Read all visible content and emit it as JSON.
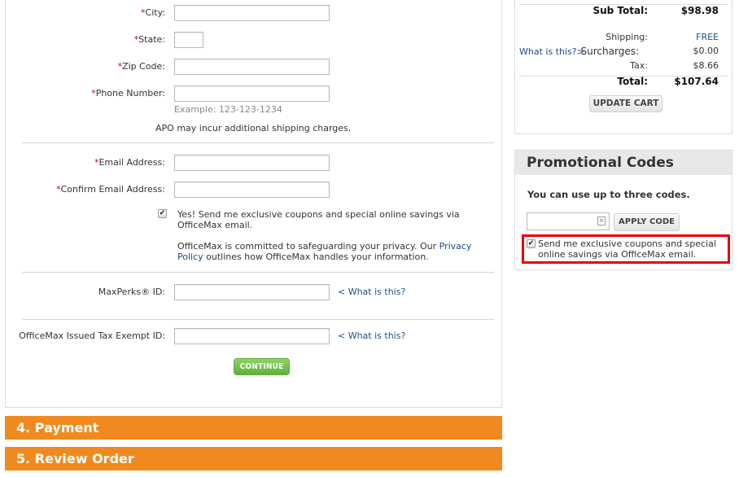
{
  "address_form": {
    "city": {
      "required_mark": "*",
      "label": "City:",
      "value": ""
    },
    "state": {
      "required_mark": "*",
      "label": "State:",
      "value": ""
    },
    "zip": {
      "required_mark": "*",
      "label": "Zip Code:",
      "value": ""
    },
    "phone": {
      "required_mark": "*",
      "label": "Phone Number:",
      "value": "",
      "hint": "Example: 123-123-1234"
    },
    "apo_note": "APO may incur additional shipping charges."
  },
  "email_form": {
    "email": {
      "required_mark": "*",
      "label": "Email Address:",
      "value": ""
    },
    "confirm_email": {
      "required_mark": "*",
      "label": "Confirm Email Address:",
      "value": ""
    },
    "optin": {
      "checked": true,
      "check_glyph": "✔",
      "text": "Yes! Send me exclusive coupons and special online savings via OfficeMax email."
    },
    "privacy": {
      "before": "OfficeMax is committed to safeguarding your privacy. Our ",
      "link": "Privacy Policy",
      "after": " outlines how OfficeMax handles your information."
    }
  },
  "ids_form": {
    "maxperks": {
      "label": "MaxPerks® ID:",
      "value": "",
      "help_link": "< What is this?"
    },
    "tax_exempt": {
      "label": "OfficeMax Issued Tax Exempt ID:",
      "value": "",
      "help_link": "< What is this?"
    },
    "continue_label": "CONTINUE"
  },
  "steps": [
    {
      "label": "4. Payment"
    },
    {
      "label": "5. Review Order"
    }
  ],
  "cart_summary": {
    "subtotal_label": "Sub Total:",
    "subtotal_value": "$98.98",
    "shipping_label": "Shipping:",
    "shipping_value": "FREE",
    "surcharges_help": "What is this?>",
    "surcharges_label": "Surcharges:",
    "surcharges_value": "$0.00",
    "tax_label": "Tax:",
    "tax_value": "$8.66",
    "total_label": "Total:",
    "total_value": "$107.64",
    "update_label": "UPDATE CART"
  },
  "promo": {
    "title": "Promotional Codes",
    "subtitle": "You can use up to three codes.",
    "code_value": "",
    "input_icon": "contact-card-icon",
    "apply_label": "APPLY CODE",
    "optin_checked": true,
    "optin_glyph": "✔",
    "optin_text": "Send me exclusive coupons and special online savings via OfficeMax email."
  },
  "colors": {
    "step_bar": "#f18a1e",
    "continue_green": "#6cc046",
    "link_blue": "#1c4f8a",
    "required_red": "#a0102a",
    "highlight_red": "#e8000b"
  }
}
